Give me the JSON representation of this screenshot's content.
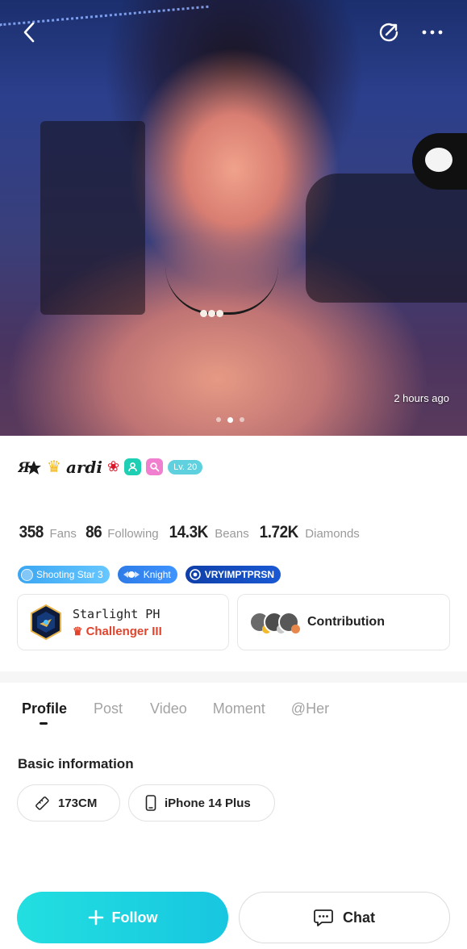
{
  "hero": {
    "time_ago": "2 hours ago",
    "dots": 3,
    "active_dot": 2
  },
  "profile": {
    "name_prefix_icon": "star-logo-icon",
    "name": "ardi",
    "level_badge": "Lv. 20"
  },
  "stats": [
    {
      "value": "358",
      "label": "Fans"
    },
    {
      "value": "86",
      "label": "Following"
    },
    {
      "value": "14.3K",
      "label": "Beans"
    },
    {
      "value": "1.72K",
      "label": "Diamonds"
    }
  ],
  "badges": [
    {
      "label": "Shooting Star 3",
      "icon": "shooting-star-icon"
    },
    {
      "label": "Knight",
      "icon": "knight-icon"
    },
    {
      "label": "VRYIMPTPRSN",
      "icon": "eye-icon"
    }
  ],
  "family_card": {
    "name": "Starlight PH",
    "rank": "Challenger III"
  },
  "contribution_card": {
    "label": "Contribution"
  },
  "tabs": [
    {
      "label": "Profile",
      "active": true
    },
    {
      "label": "Post",
      "active": false
    },
    {
      "label": "Video",
      "active": false
    },
    {
      "label": "Moment",
      "active": false
    },
    {
      "label": "@Her",
      "active": false
    }
  ],
  "basic_info": {
    "title": "Basic information",
    "height": "173CM",
    "device": "iPhone 14 Plus"
  },
  "actions": {
    "follow_label": "Follow",
    "chat_label": "Chat"
  },
  "colors": {
    "accent": "#1fd6df",
    "rank_red": "#e0442c",
    "badge_blue": "#2d7be6"
  }
}
